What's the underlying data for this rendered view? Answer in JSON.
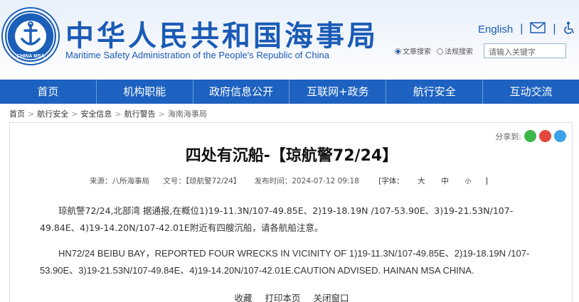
{
  "header": {
    "title": "中华人民共和国海事局",
    "subtitle": "Maritime Safety Administration of the People's Republic of China",
    "logo_text": "CHINA MSA",
    "english_link": "English",
    "sep": "|",
    "search_option_1": "文章搜索",
    "search_option_2": "法规搜索",
    "search_placeholder": "请输入关键字"
  },
  "nav": {
    "items": [
      "首页",
      "机构职能",
      "政府信息公开",
      "互联网+政务",
      "航行安全",
      "互动交流"
    ]
  },
  "breadcrumb": {
    "items": [
      "首页",
      "航行安全",
      "安全信息",
      "航行警告",
      "海南海事局"
    ],
    "sep": ">"
  },
  "article": {
    "share_label": "分享到:",
    "title": "四处有沉船-【琼航警72/24】",
    "source": "来源：八所海事局",
    "doc_no": "文号：【琼航警72/24】",
    "publish_time": "发布时间：2024-07-12 09:18",
    "font_size_label": "[字体：",
    "font_large": "大",
    "font_medium": "中",
    "font_small": "小",
    "font_close": "]",
    "para_cn": "琼航警72/24,北部湾 据通报,在概位1)19-11.3N/107-49.85E、2)19-18.19N /107-53.90E、3)19-21.53N/107-49.84E、4)19-14.20N/107-42.01E附近有四艘沉船，请各航船注意。",
    "para_en": "HN72/24 BEIBU BAY，REPORTED FOUR  WRECKS IN VICINITY OF 1)19-11.3N/107-49.85E、2)19-18.19N /107-53.90E、3)19-21.53N/107-49.84E、4)19-14.20N/107-42.01E.CAUTION ADVISED. HAINAN MSA CHINA.",
    "actions": [
      "收藏",
      "打印本页",
      "关闭窗口"
    ]
  },
  "colors": {
    "brand_blue": "#1d62c0",
    "share_wechat": "#3cb64a",
    "share_weibo": "#e2483d",
    "share_qq": "#3aa2e8"
  }
}
